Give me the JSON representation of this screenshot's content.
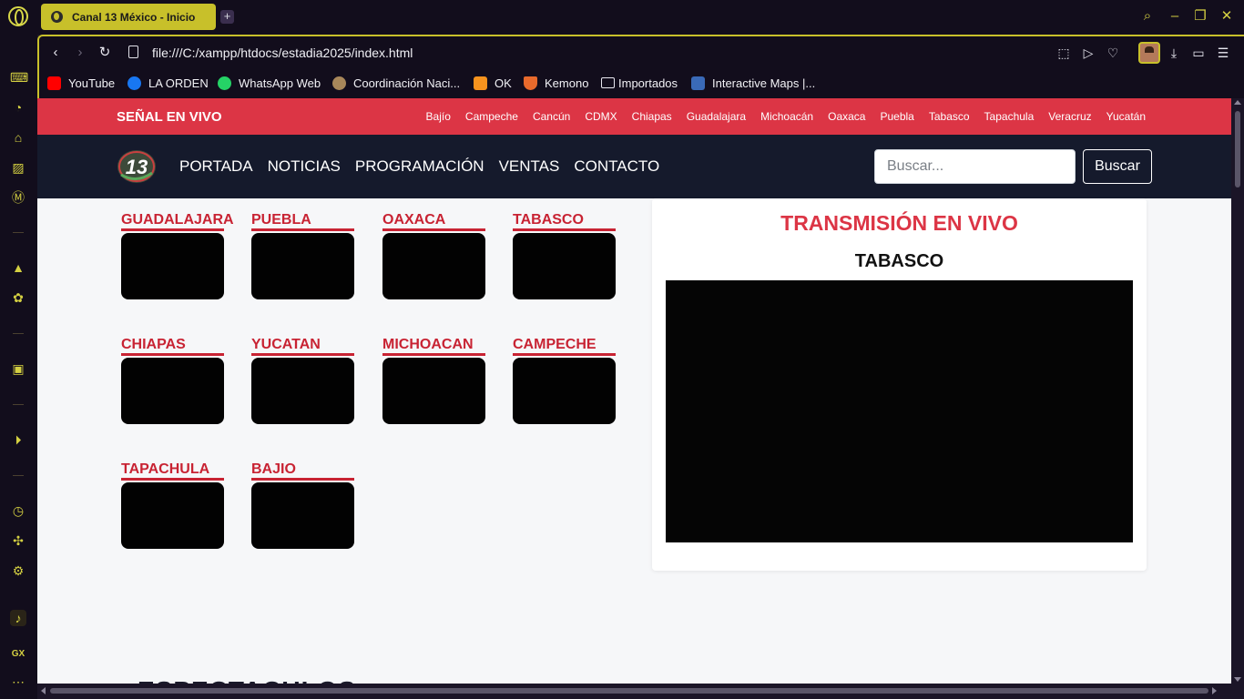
{
  "browser": {
    "tab_title": "Canal 13 México - Inicio",
    "new_tab_label": "+",
    "url": "file:///C:/xampp/htdocs/estadia2025/index.html"
  },
  "bookmarks": [
    {
      "label": "YouTube",
      "icon": "youtube-icon",
      "color": "#ff0000"
    },
    {
      "label": "LA ORDEN",
      "icon": "facebook-icon",
      "color": "#1877f2"
    },
    {
      "label": "WhatsApp Web",
      "icon": "whatsapp-icon",
      "color": "#25d366"
    },
    {
      "label": "Coordinación Naci...",
      "icon": "seal-icon",
      "color": "#a8875a"
    },
    {
      "label": "OK",
      "icon": "ok-icon",
      "color": "#f7931e"
    },
    {
      "label": "Kemono",
      "icon": "kemono-icon",
      "color": "#e86a2c"
    },
    {
      "label": "Importados",
      "icon": "folder-icon",
      "color": "#e8e8f0"
    },
    {
      "label": "Interactive Maps |...",
      "icon": "maps-icon",
      "color": "#3a6ab8"
    }
  ],
  "site": {
    "live_title": "SEÑAL EN VIVO",
    "regions": [
      "Bajío",
      "Campeche",
      "Cancún",
      "CDMX",
      "Chiapas",
      "Guadalajara",
      "Michoacán",
      "Oaxaca",
      "Puebla",
      "Tabasco",
      "Tapachula",
      "Veracruz",
      "Yucatán"
    ],
    "nav": [
      "PORTADA",
      "NOTICIAS",
      "PROGRAMACIÓN",
      "VENTAS",
      "CONTACTO"
    ],
    "logo_text": "13",
    "search_placeholder": "Buscar...",
    "search_button": "Buscar",
    "stations": [
      "GUADALAJARA",
      "PUEBLA",
      "OAXACA",
      "TABASCO",
      "CHIAPAS",
      "YUCATAN",
      "MICHOACAN",
      "CAMPECHE",
      "TAPACHULA",
      "BAJIO"
    ],
    "live_panel_title": "TRANSMISIÓN EN VIVO",
    "live_panel_station": "TABASCO",
    "bottom_heading": "ESPECTACULOS"
  },
  "colors": {
    "accent_red": "#dc3545",
    "header_dark": "#151a2c",
    "browser_accent": "#c8c02a"
  }
}
